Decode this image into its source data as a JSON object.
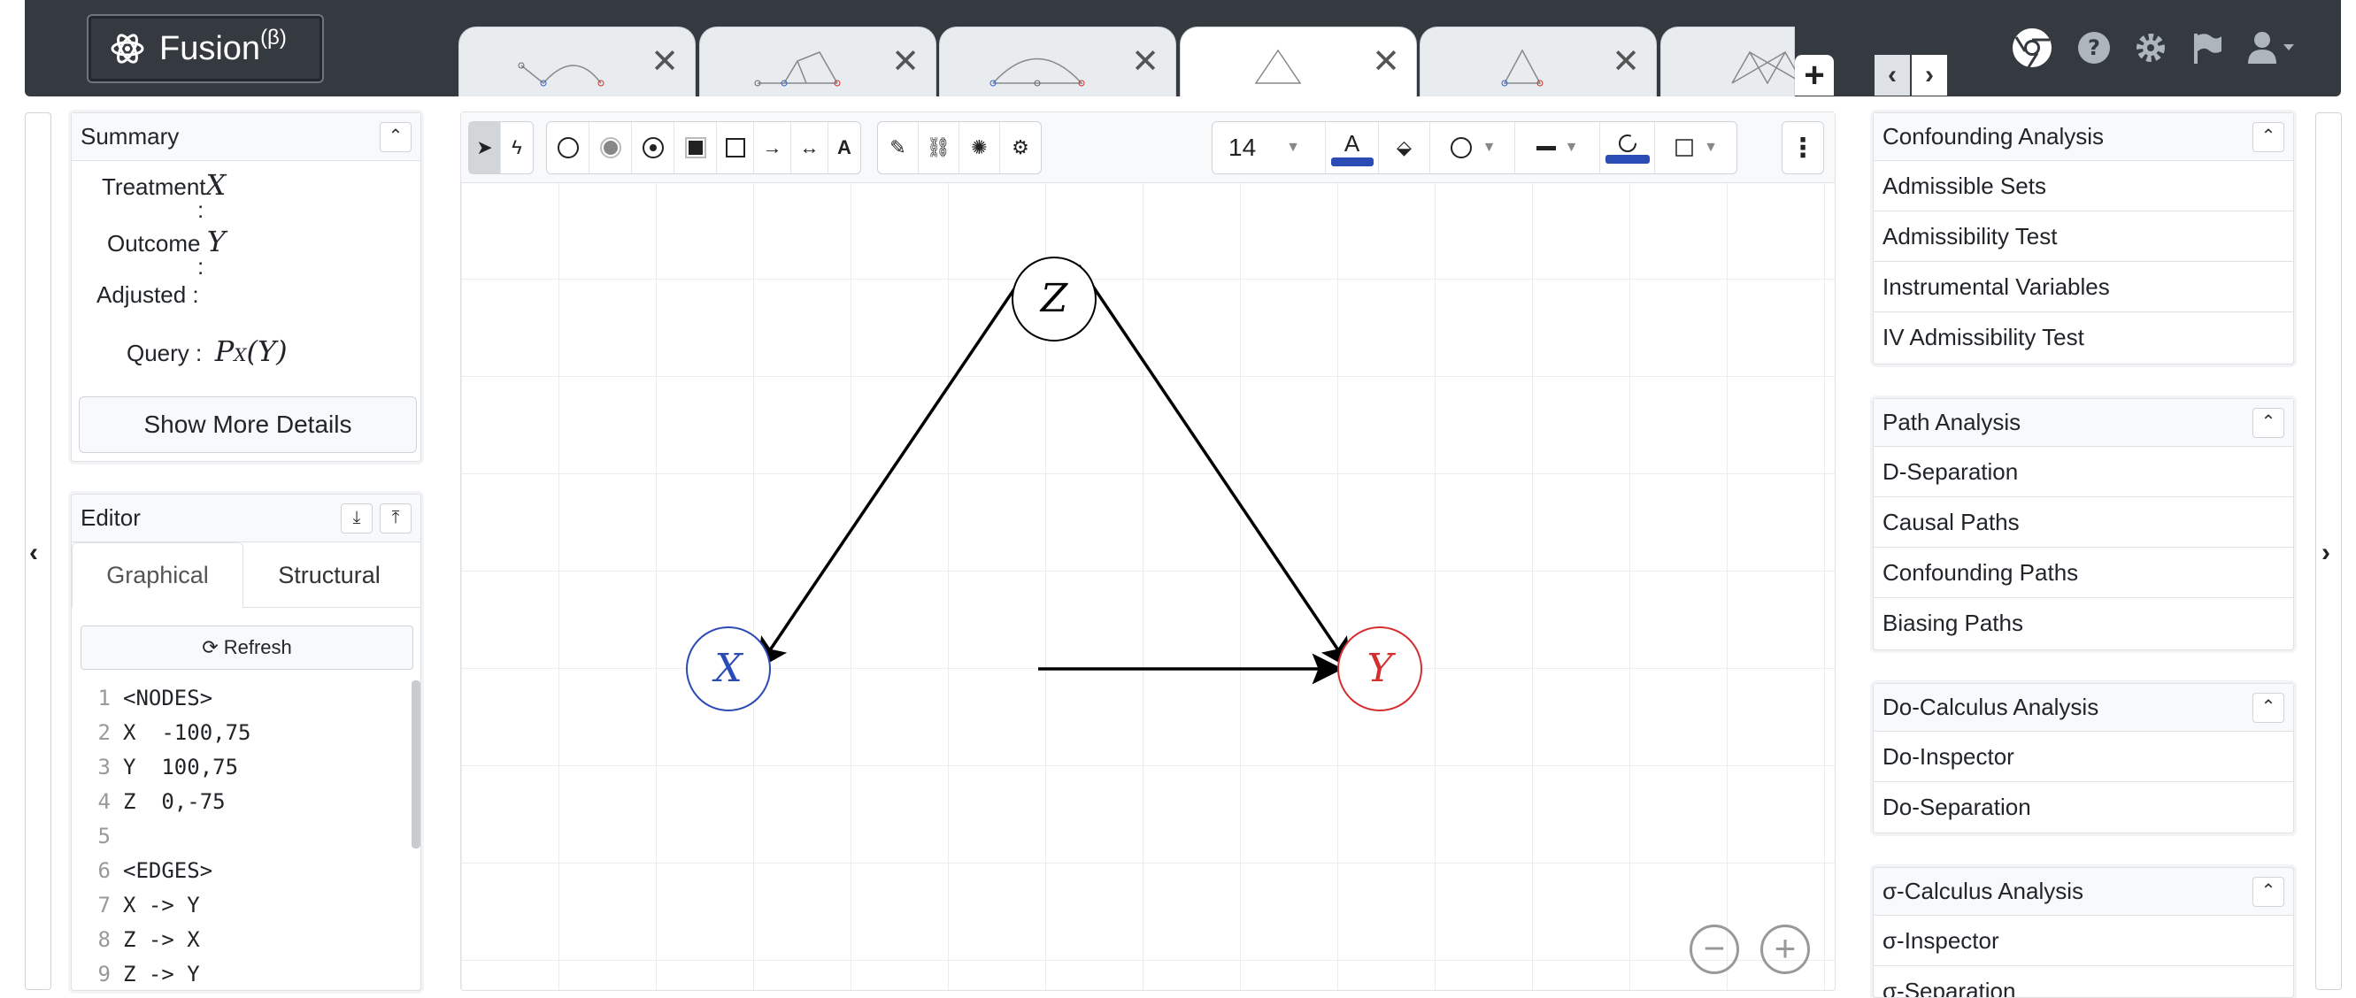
{
  "app": {
    "brand": "Fusion",
    "brand_sup": "(β)"
  },
  "tabs": [
    {
      "thumb": "line-arc",
      "active": false
    },
    {
      "thumb": "triangles",
      "active": false
    },
    {
      "thumb": "arc",
      "active": false
    },
    {
      "thumb": "triangle",
      "active": true
    },
    {
      "thumb": "triangle-small",
      "active": false
    },
    {
      "thumb": "lattice",
      "active": false
    }
  ],
  "summary": {
    "title": "Summary",
    "treatment_label": "Treatment",
    "treatment_value": "X",
    "outcome_label": "Outcome",
    "outcome_value": "Y",
    "adjusted_label": "Adjusted",
    "colon": ":",
    "query_label": "Query :",
    "query_value": "P",
    "query_sub": "X",
    "query_arg": "(Y)",
    "more_button": "Show More Details"
  },
  "editor": {
    "title": "Editor",
    "tab_graphical": "Graphical",
    "tab_structural": "Structural",
    "refresh": "Refresh",
    "lines": [
      "<NODES>",
      "X  -100,75",
      "Y  100,75",
      "Z  0,-75",
      "",
      "<EDGES>",
      "X -> Y",
      "Z -> X",
      "Z -> Y"
    ],
    "line_numbers": [
      "1",
      "2",
      "3",
      "4",
      "5",
      "6",
      "7",
      "8",
      "9"
    ]
  },
  "toolbar": {
    "font_size": "14",
    "text_tool": "A",
    "accent_blue": "#2b4bb5"
  },
  "graph": {
    "nodes": [
      {
        "id": "Z",
        "label": "Z",
        "color": "#000000"
      },
      {
        "id": "X",
        "label": "X",
        "color": "#2b4bb5"
      },
      {
        "id": "Y",
        "label": "Y",
        "color": "#d32f2f"
      }
    ],
    "edges": [
      [
        "X",
        "Y"
      ],
      [
        "Z",
        "X"
      ],
      [
        "Z",
        "Y"
      ]
    ]
  },
  "right": {
    "confounding": {
      "title": "Confounding Analysis",
      "items": [
        "Admissible Sets",
        "Admissibility Test",
        "Instrumental Variables",
        "IV Admissibility Test"
      ]
    },
    "path": {
      "title": "Path Analysis",
      "items": [
        "D-Separation",
        "Causal Paths",
        "Confounding Paths",
        "Biasing Paths"
      ]
    },
    "docalc": {
      "title": "Do-Calculus Analysis",
      "items": [
        "Do-Inspector",
        "Do-Separation"
      ]
    },
    "sigma": {
      "title": "σ-Calculus Analysis",
      "items": [
        "σ-Inspector",
        "σ-Separation"
      ]
    }
  }
}
